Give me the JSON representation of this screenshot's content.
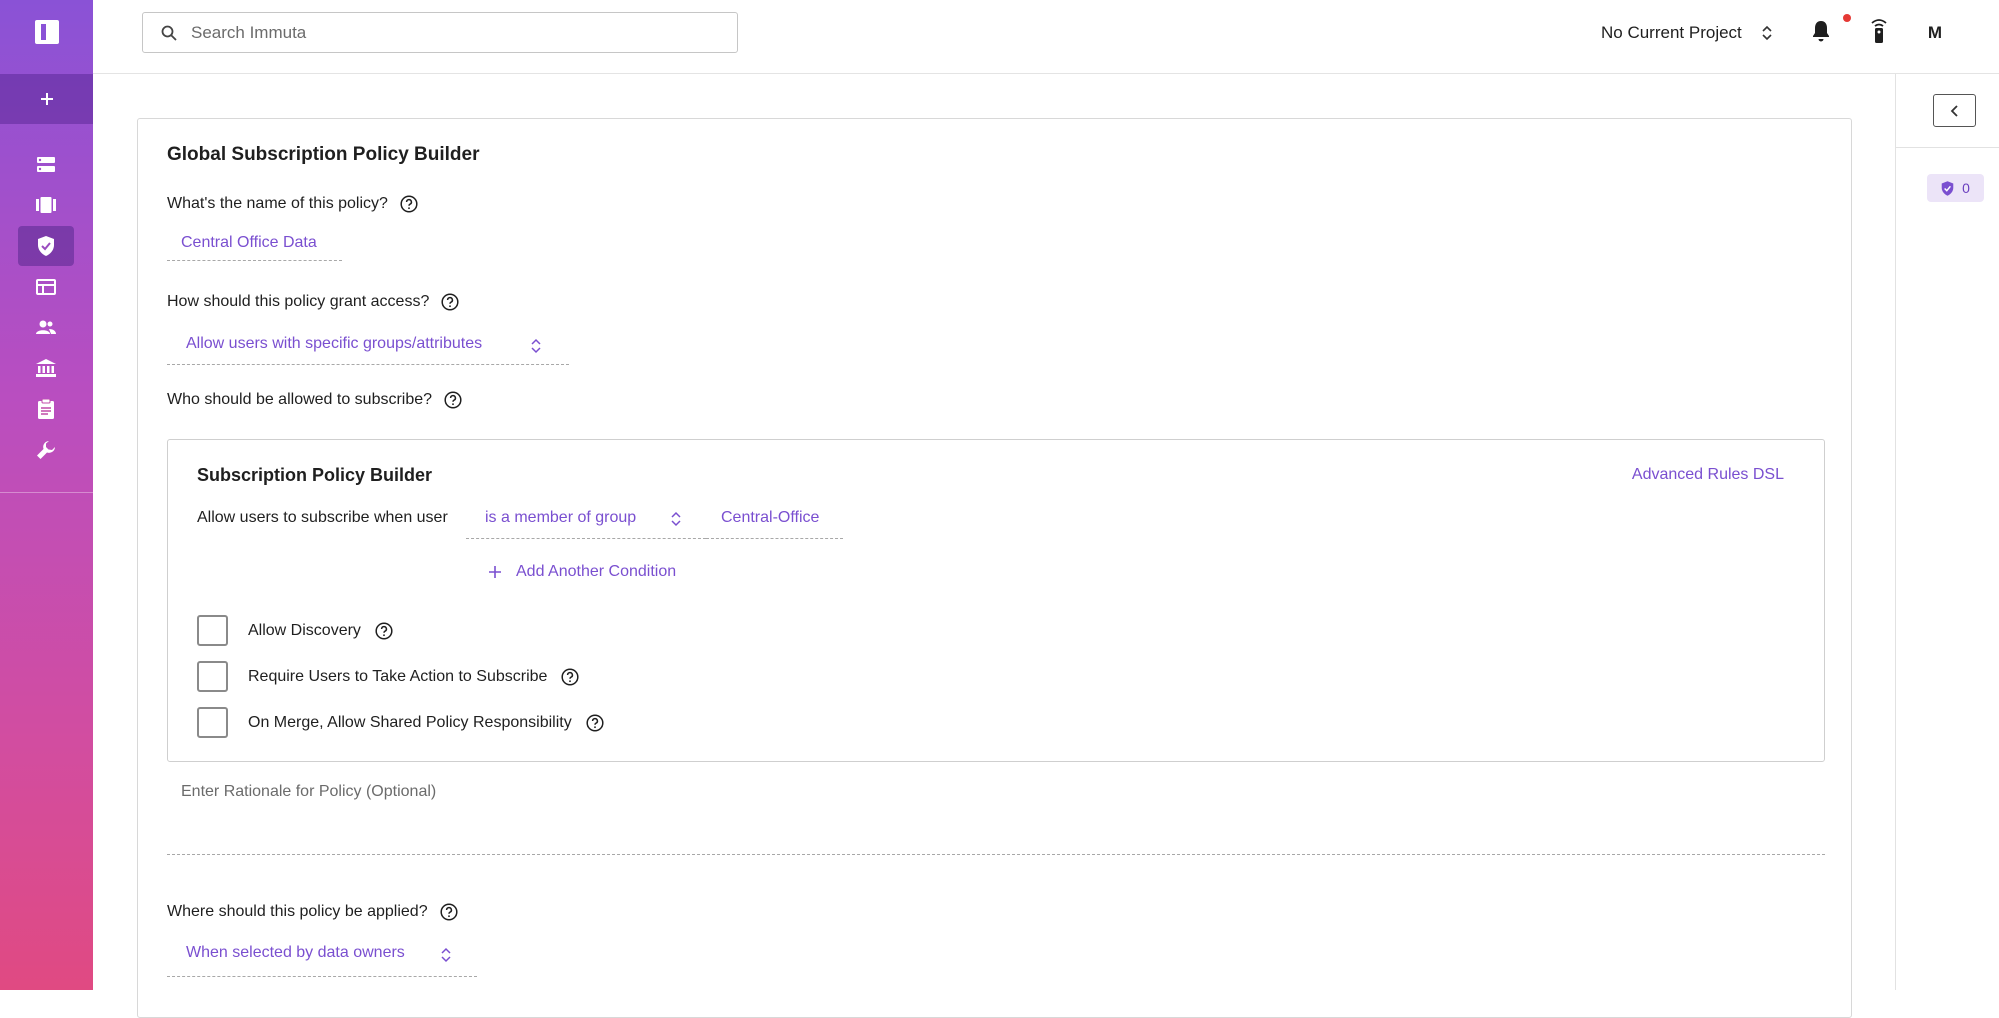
{
  "app": {
    "logo_icon": "immuta-logo-icon",
    "brand_gradient": [
      "#8a52d6",
      "#e04a82"
    ],
    "accent": "#7a4fd0"
  },
  "sidebar": {
    "add_icon": "plus-icon",
    "items": [
      {
        "name": "data-sources",
        "icon": "server-stack-icon"
      },
      {
        "name": "projects",
        "icon": "briefcase-icon"
      },
      {
        "name": "policies",
        "icon": "shield-check-icon",
        "active": true
      },
      {
        "name": "queries",
        "icon": "table-icon"
      },
      {
        "name": "people",
        "icon": "people-icon"
      },
      {
        "name": "governance",
        "icon": "bank-icon"
      },
      {
        "name": "audit",
        "icon": "clipboard-icon"
      },
      {
        "name": "app-settings",
        "icon": "wrench-icon"
      }
    ]
  },
  "topbar": {
    "search_placeholder": "Search Immuta",
    "project_label": "No Current Project",
    "avatar_initial": "M"
  },
  "right_panel": {
    "policy_count": "0"
  },
  "form": {
    "title": "Global Subscription Policy Builder",
    "name_question": "What's the name of this policy?",
    "name_value": "Central Office Data",
    "grant_question": "How should this policy grant access?",
    "grant_value": "Allow users with specific groups/attributes",
    "who_question": "Who should be allowed to subscribe?",
    "builder": {
      "title": "Subscription Policy Builder",
      "advanced_link": "Advanced Rules DSL",
      "condition_prefix": "Allow users to subscribe when user",
      "condition_operator": "is a member of group",
      "condition_value": "Central-Office",
      "add_condition": "Add Another Condition",
      "checkboxes": [
        {
          "label": "Allow Discovery",
          "checked": false
        },
        {
          "label": "Require Users to Take Action to Subscribe",
          "checked": false
        },
        {
          "label": "On Merge, Allow Shared Policy Responsibility",
          "checked": false
        }
      ]
    },
    "rationale_placeholder": "Enter Rationale for Policy (Optional)",
    "where_question": "Where should this policy be applied?",
    "where_value": "When selected by data owners"
  }
}
